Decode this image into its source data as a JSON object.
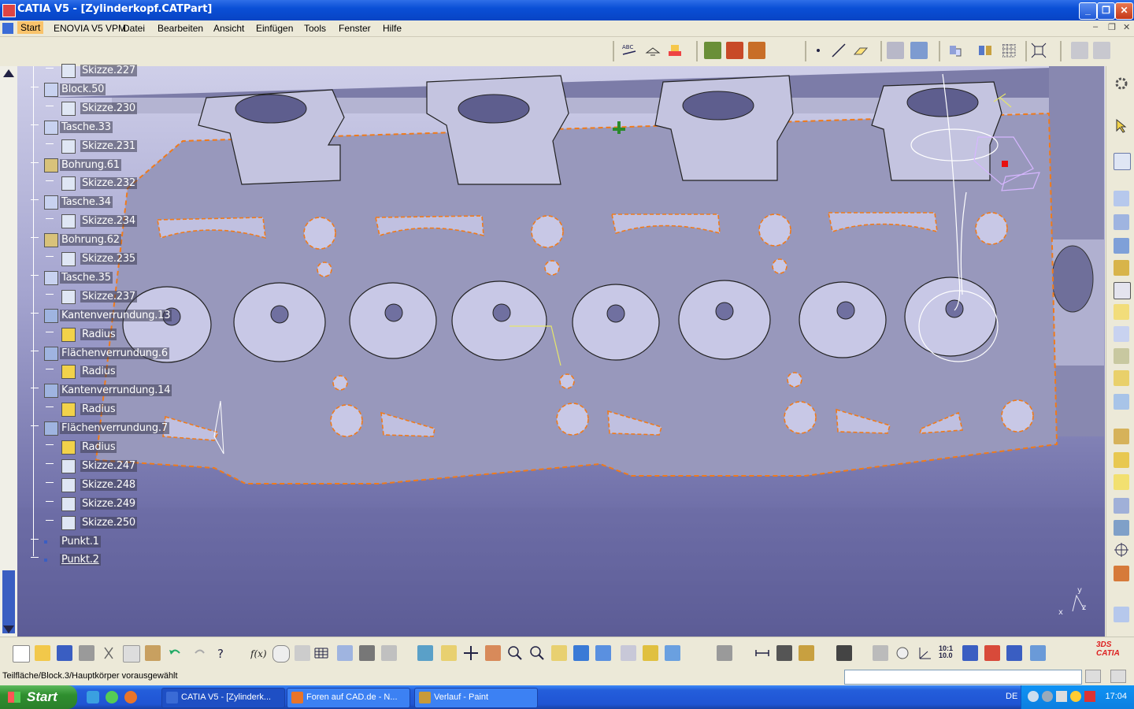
{
  "window": {
    "title": "CATIA V5 - [Zylinderkopf.CATPart]",
    "minimize": "_",
    "restore": "❐",
    "close": "✕"
  },
  "menu": {
    "start": "Start",
    "enovia": "ENOVIA V5 VPM",
    "datei": "Datei",
    "bearbeiten": "Bearbeiten",
    "ansicht": "Ansicht",
    "einfuegen": "Einfügen",
    "tools": "Tools",
    "fenster": "Fenster",
    "hilfe": "Hilfe"
  },
  "spec_tree": {
    "items": [
      {
        "label": "Skizze.227",
        "type": "sketch"
      },
      {
        "label": "Block.50",
        "type": "pad"
      },
      {
        "label": "Skizze.230",
        "type": "sketch"
      },
      {
        "label": "Tasche.33",
        "type": "pocket"
      },
      {
        "label": "Skizze.231",
        "type": "sketch"
      },
      {
        "label": "Bohrung.61",
        "type": "hole"
      },
      {
        "label": "Skizze.232",
        "type": "sketch"
      },
      {
        "label": "Tasche.34",
        "type": "pocket"
      },
      {
        "label": "Skizze.234",
        "type": "sketch"
      },
      {
        "label": "Bohrung.62",
        "type": "hole"
      },
      {
        "label": "Skizze.235",
        "type": "sketch"
      },
      {
        "label": "Tasche.35",
        "type": "pocket"
      },
      {
        "label": "Skizze.237",
        "type": "sketch"
      },
      {
        "label": "Kantenverrundung.13",
        "type": "fillet"
      },
      {
        "label": "Radius",
        "type": "parameter"
      },
      {
        "label": "Flächenverrundung.6",
        "type": "fillet"
      },
      {
        "label": "Radius",
        "type": "parameter"
      },
      {
        "label": "Kantenverrundung.14",
        "type": "fillet"
      },
      {
        "label": "Radius",
        "type": "parameter"
      },
      {
        "label": "Flächenverrundung.7",
        "type": "fillet"
      },
      {
        "label": "Radius",
        "type": "parameter"
      },
      {
        "label": "Skizze.247",
        "type": "sketch"
      },
      {
        "label": "Skizze.248",
        "type": "sketch"
      },
      {
        "label": "Skizze.249",
        "type": "sketch"
      },
      {
        "label": "Skizze.250",
        "type": "sketch"
      },
      {
        "label": "Punkt.1",
        "type": "point"
      },
      {
        "label": "Punkt.2",
        "type": "point"
      }
    ]
  },
  "compass": {
    "x": "x",
    "y": "y",
    "z": "z"
  },
  "status": {
    "text": "Teilfläche/Block.3/Hauptkörper vorausgewählt",
    "command_input": ""
  },
  "taskbar": {
    "start": "Start",
    "tasks": [
      {
        "label": "CATIA V5 - [Zylinderk...",
        "active": true
      },
      {
        "label": "Foren auf CAD.de - N...",
        "active": false
      },
      {
        "label": "Verlauf - Paint",
        "active": false
      }
    ],
    "language": "DE",
    "clock": "17:04"
  },
  "toolbar_labels": {
    "abc": "ABC",
    "scale": "10:1\n10.0"
  },
  "colors": {
    "title_bar": "#0a4fd6",
    "viewport_top": "#cfcfe9",
    "viewport_bottom": "#55558f",
    "part_face": "#9292b6",
    "highlight_edge": "#f07a1a",
    "taskbar": "#245edb"
  }
}
